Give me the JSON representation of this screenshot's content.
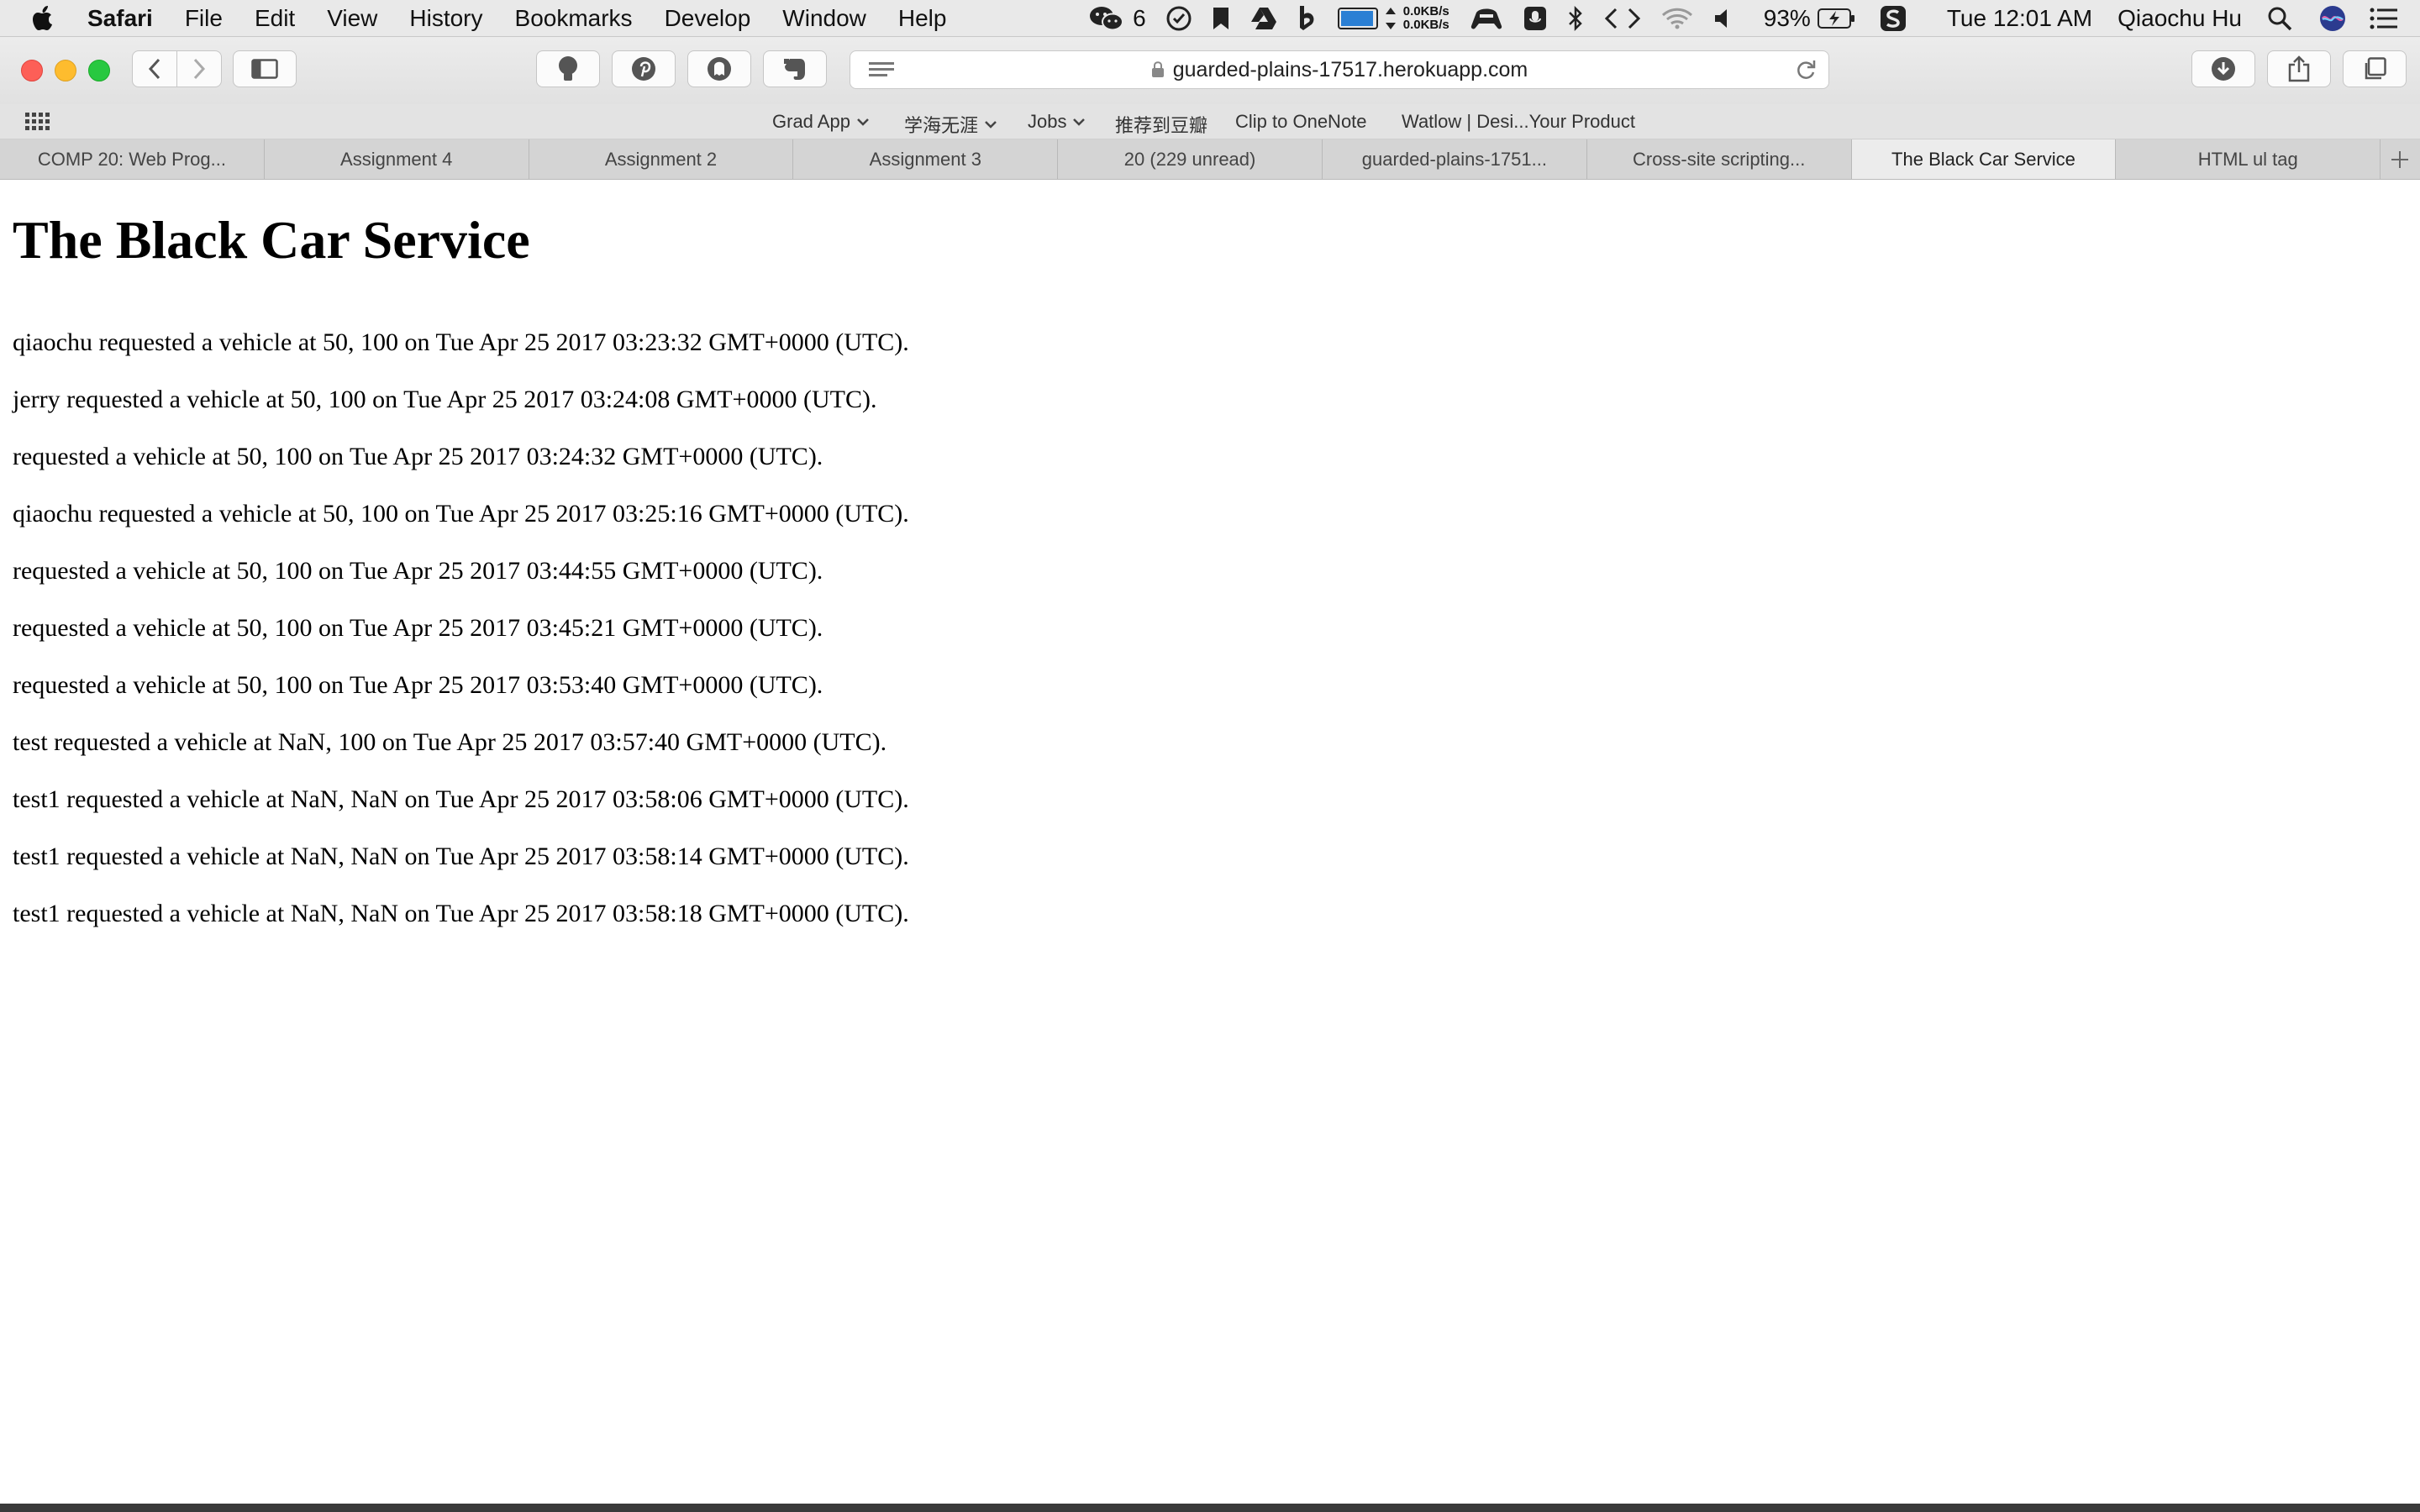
{
  "menubar": {
    "app_name": "Safari",
    "menus": [
      "File",
      "Edit",
      "View",
      "History",
      "Bookmarks",
      "Develop",
      "Window",
      "Help"
    ],
    "wechat_badge": "6",
    "net_up": "0.0KB/s",
    "net_down": "0.0KB/s",
    "battery_percent": "93%",
    "clock": "Tue 12:01 AM",
    "user_name": "Qiaochu Hu"
  },
  "toolbar": {
    "url": "guarded-plains-17517.herokuapp.com"
  },
  "favorites": [
    {
      "label": "Grad App",
      "has_menu": true
    },
    {
      "label": "学海无涯",
      "has_menu": true
    },
    {
      "label": "Jobs",
      "has_menu": true
    },
    {
      "label": "推荐到豆瓣",
      "has_menu": false
    },
    {
      "label": "Clip to OneNote",
      "has_menu": false
    },
    {
      "label": "Watlow | Desi...Your Product",
      "has_menu": false
    }
  ],
  "tabs": [
    {
      "label": "COMP 20: Web Prog...",
      "active": false
    },
    {
      "label": "Assignment 4",
      "active": false
    },
    {
      "label": "Assignment 2",
      "active": false
    },
    {
      "label": "Assignment 3",
      "active": false
    },
    {
      "label": "20 (229 unread)",
      "active": false
    },
    {
      "label": "guarded-plains-1751...",
      "active": false
    },
    {
      "label": "Cross-site scripting...",
      "active": false
    },
    {
      "label": "The Black Car Service",
      "active": true
    },
    {
      "label": "HTML ul tag",
      "active": false
    }
  ],
  "page": {
    "title": "The Black Car Service",
    "entries": [
      "qiaochu requested a vehicle at 50, 100 on Tue Apr 25 2017 03:23:32 GMT+0000 (UTC).",
      "jerry requested a vehicle at 50, 100 on Tue Apr 25 2017 03:24:08 GMT+0000 (UTC).",
      "requested a vehicle at 50, 100 on Tue Apr 25 2017 03:24:32 GMT+0000 (UTC).",
      "qiaochu requested a vehicle at 50, 100 on Tue Apr 25 2017 03:25:16 GMT+0000 (UTC).",
      "requested a vehicle at 50, 100 on Tue Apr 25 2017 03:44:55 GMT+0000 (UTC).",
      "requested a vehicle at 50, 100 on Tue Apr 25 2017 03:45:21 GMT+0000 (UTC).",
      "requested a vehicle at 50, 100 on Tue Apr 25 2017 03:53:40 GMT+0000 (UTC).",
      "test requested a vehicle at NaN, 100 on Tue Apr 25 2017 03:57:40 GMT+0000 (UTC).",
      "test1 requested a vehicle at NaN, NaN on Tue Apr 25 2017 03:58:06 GMT+0000 (UTC).",
      "test1 requested a vehicle at NaN, NaN on Tue Apr 25 2017 03:58:14 GMT+0000 (UTC).",
      "test1 requested a vehicle at NaN, NaN on Tue Apr 25 2017 03:58:18 GMT+0000 (UTC)."
    ]
  },
  "colors": {
    "close": "#fd5f57",
    "minimize": "#febc2e",
    "zoom": "#28c840",
    "battery_fill": "#2a7fd4"
  }
}
